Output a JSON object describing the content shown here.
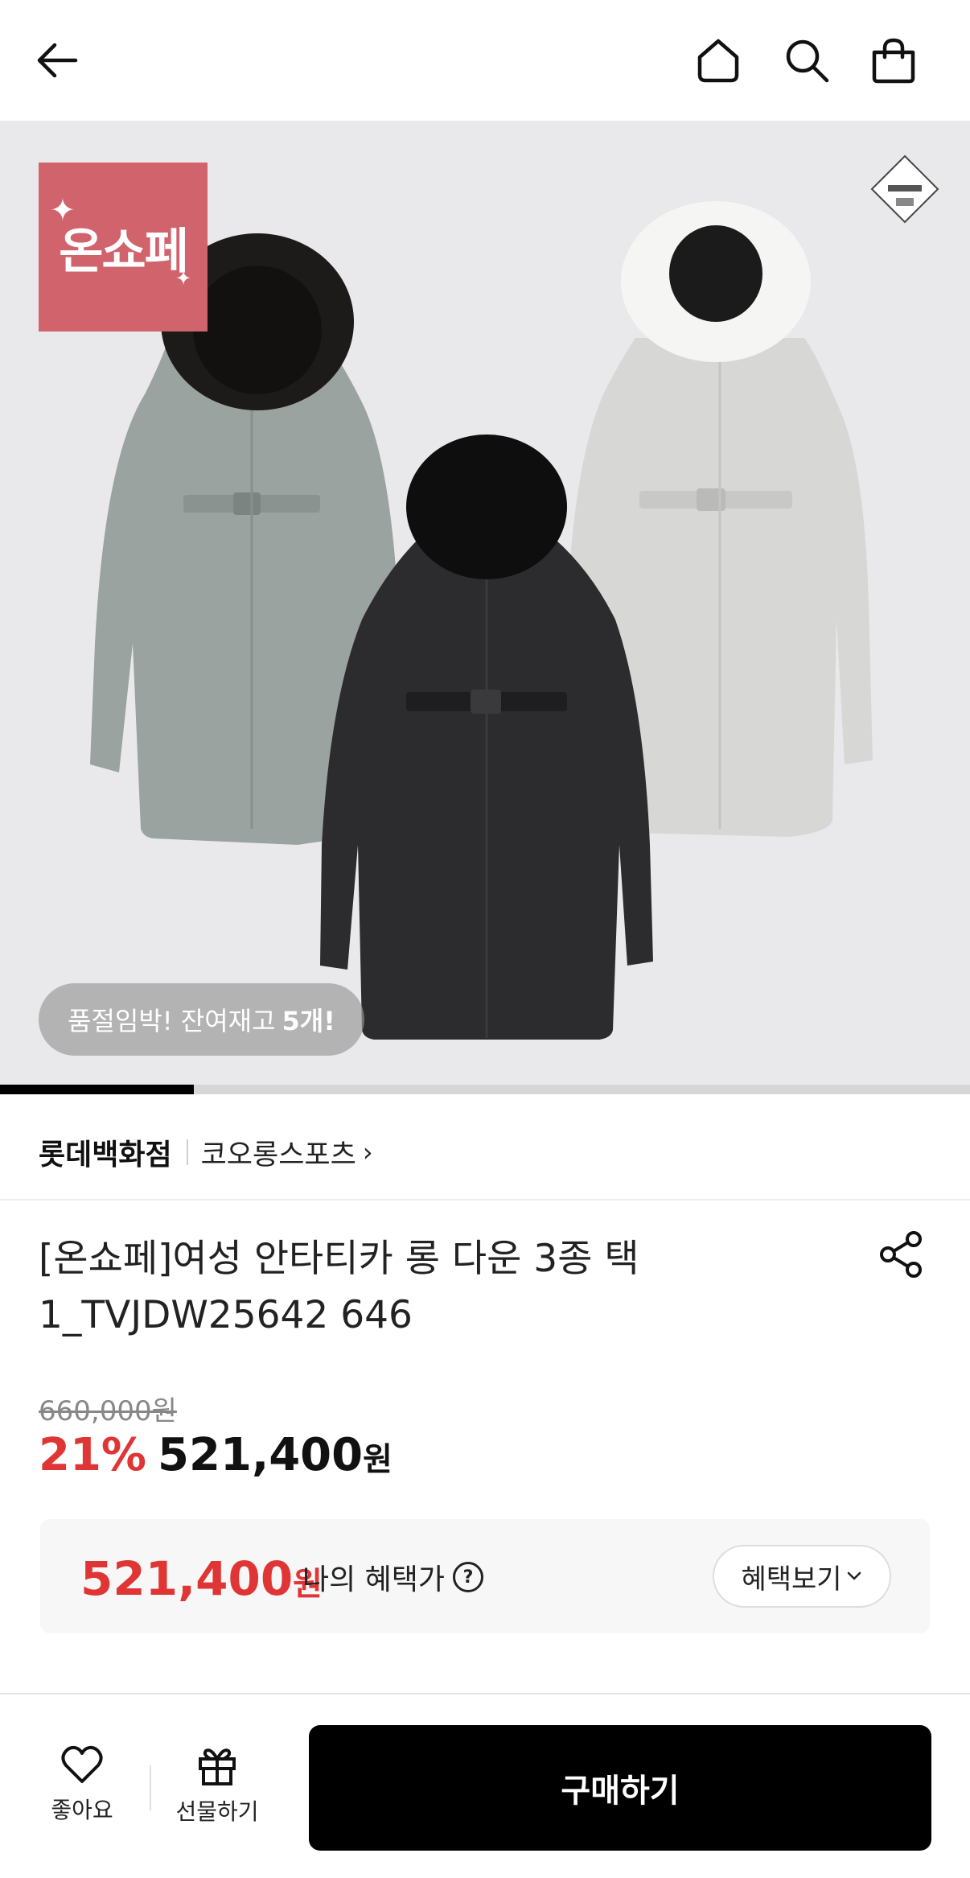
{
  "header": {
    "icons": [
      "back-arrow-icon",
      "home-icon",
      "search-icon",
      "shopping-bag-icon"
    ]
  },
  "hero": {
    "badge_text": "온쇼페",
    "stock_text": "품절임박! 잔여재고",
    "stock_count": "5개!",
    "slide_progress": 0.2,
    "badge_color": "#d0636c"
  },
  "brand": {
    "store": "롯데백화점",
    "brand_name": "코오롱스포츠"
  },
  "product": {
    "title_line1": "[온쇼페]여성 안타티카 롱 다운 3종 택",
    "title_line2": "1_TVJDW25642 646"
  },
  "price": {
    "original": "660,000원",
    "discount": "21%",
    "sale": "521,400",
    "won": "원",
    "accent_color": "#e03535"
  },
  "benefit": {
    "price": "521,400",
    "unit": "원",
    "label": "나의 혜택가",
    "button_label": "혜택보기"
  },
  "bottom": {
    "like_label": "좋아요",
    "gift_label": "선물하기",
    "buy_label": "구매하기"
  }
}
